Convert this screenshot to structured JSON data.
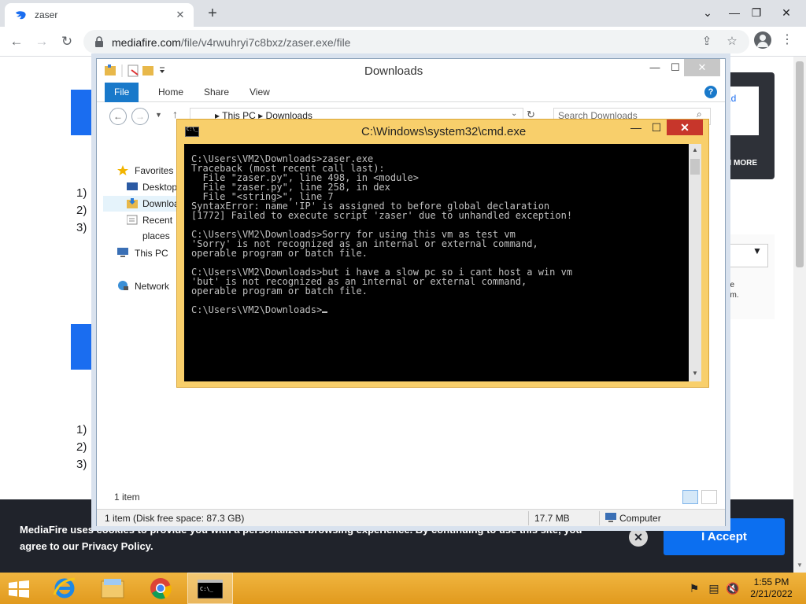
{
  "browser": {
    "tab_title": "zaser",
    "tab_close": "✕",
    "new_tab": "+",
    "win_minimize": "⌄",
    "win_min": "—",
    "win_restore": "❐",
    "win_close": "✕",
    "url_host": "mediafire.com",
    "url_path": "/file/v4rwuhryi7c8bxz/zaser.exe/file"
  },
  "page": {
    "steps_1": [
      "1)",
      "2)",
      "3)"
    ],
    "steps_2": [
      "1)",
      "2)",
      "3)"
    ],
    "right_link": "ad",
    "right_more": "N MORE",
    "right_text": "he\nem.",
    "cookie_text": "MediaFire uses cookies to provide you with a personalized browsing experience. By continuing to use this site, you agree to our Privacy Policy.",
    "accept_label": "I Accept",
    "cookie_close": "✕"
  },
  "explorer": {
    "title": "Downloads",
    "tabs": [
      "File",
      "Home",
      "Share",
      "View"
    ],
    "help": "?",
    "breadcrumb_1": "This PC",
    "breadcrumb_2": "Downloads",
    "search_placeholder": "Search Downloads",
    "sidebar": [
      {
        "label": "Favorites",
        "icon": "star-icon"
      },
      {
        "label": "Desktop",
        "icon": "desktop-icon"
      },
      {
        "label": "Downloads",
        "icon": "downloads-folder-icon"
      },
      {
        "label": "Recent places",
        "icon": "recent-places-icon"
      },
      {
        "label": "This PC",
        "icon": "computer-icon"
      },
      {
        "label": "Network",
        "icon": "network-icon"
      }
    ],
    "item_count": "1 item",
    "status_space": "1 item (Disk free space: 87.3 GB)",
    "status_size": "17.7 MB",
    "status_location": "Computer",
    "minimize": "—",
    "maximize": "☐",
    "close": "✕"
  },
  "cmd": {
    "title": "C:\\Windows\\system32\\cmd.exe",
    "minimize": "—",
    "maximize": "☐",
    "close": "✕",
    "output": "C:\\Users\\VM2\\Downloads>zaser.exe\nTraceback (most recent call last):\n  File \"zaser.py\", line 498, in <module>\n  File \"zaser.py\", line 258, in dex\n  File \"<string>\", line 7\nSyntaxError: name 'IP' is assigned to before global declaration\n[1772] Failed to execute script 'zaser' due to unhandled exception!\n\nC:\\Users\\VM2\\Downloads>Sorry for using this vm as test vm\n'Sorry' is not recognized as an internal or external command,\noperable program or batch file.\n\nC:\\Users\\VM2\\Downloads>but i have a slow pc so i cant host a win vm\n'but' is not recognized as an internal or external command,\noperable program or batch file.\n\nC:\\Users\\VM2\\Downloads>"
  },
  "taskbar": {
    "time": "1:55 PM",
    "date": "2/21/2022"
  },
  "colors": {
    "accent_blue": "#1a6df0",
    "cmd_frame": "#f8cf6b",
    "taskbar": "#e8a32c"
  }
}
